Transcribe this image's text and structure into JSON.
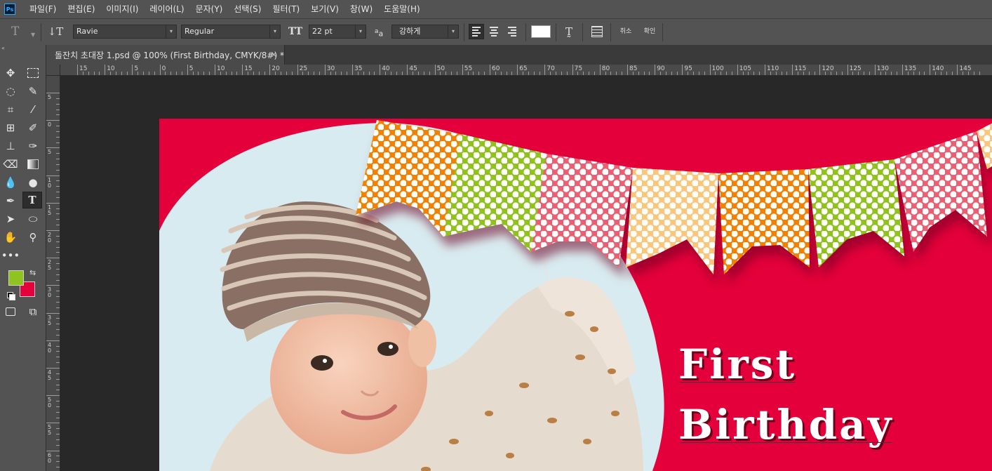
{
  "app": {
    "logo": "Ps"
  },
  "menu": [
    "파일(F)",
    "편집(E)",
    "이미지(I)",
    "레이어(L)",
    "문자(Y)",
    "선택(S)",
    "필터(T)",
    "보기(V)",
    "창(W)",
    "도움말(H)"
  ],
  "options": {
    "font_family": "Ravie",
    "font_style": "Regular",
    "font_size": "22 pt",
    "aa_label": "a",
    "aa_mode": "강하게",
    "cancel_label": "취소",
    "commit_label": "확인",
    "text_color": "#ffffff"
  },
  "document": {
    "tab_title": "돌잔치 초대장 1.psd @ 100% (First Birthday, CMYK/8#) *",
    "close_glyph": "×"
  },
  "colors": {
    "foreground": "#8fc31f",
    "background": "#e4003b"
  },
  "ruler": {
    "h_labels": [
      "15",
      "10",
      "5",
      "0",
      "5",
      "10",
      "15",
      "20",
      "25",
      "30",
      "35",
      "40",
      "45",
      "50",
      "55",
      "60",
      "65",
      "70",
      "75",
      "80",
      "85",
      "90",
      "95",
      "100",
      "105",
      "110",
      "115",
      "120",
      "125",
      "130",
      "135",
      "140",
      "145"
    ],
    "v_labels": [
      "5",
      "0",
      "5",
      "10",
      "15",
      "20",
      "25",
      "30",
      "35",
      "40",
      "45",
      "50",
      "55",
      "60"
    ]
  },
  "canvas": {
    "text_lines": [
      "First",
      "Birthday"
    ],
    "bunting_colors": [
      "#f08200",
      "#8fc31f",
      "#ea5e72",
      "#fbc67a",
      "#f08200",
      "#8fc31f",
      "#ea5e72",
      "#fbc67a"
    ]
  }
}
